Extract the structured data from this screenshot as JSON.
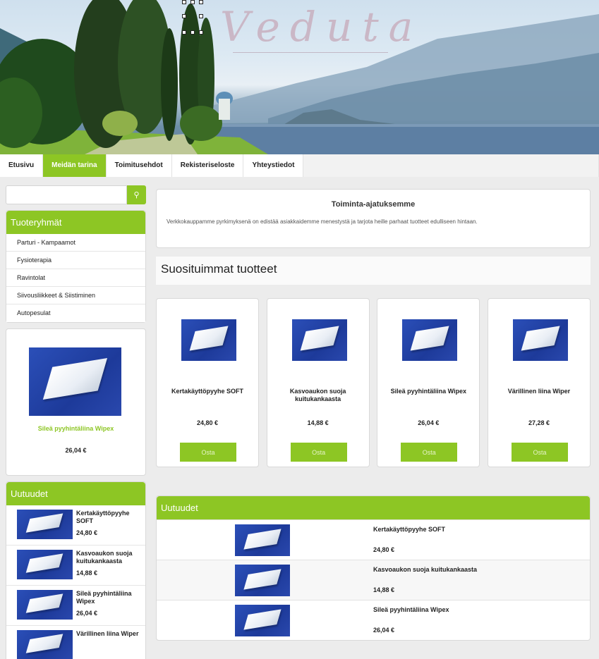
{
  "brand": {
    "logo": "Veduta"
  },
  "nav": [
    "Etusivu",
    "Meidän tarina",
    "Toimitusehdot",
    "Rekisteriseloste",
    "Yhteystiedot"
  ],
  "search": {
    "placeholder": "",
    "button_icon": "search-icon"
  },
  "categories": {
    "title": "Tuoteryhmät",
    "items": [
      "Parturi - Kampaamot",
      "Fysioterapia",
      "Ravintolat",
      "Siivousliikkeet & Siistiminen",
      "Autopesulat"
    ]
  },
  "featured": {
    "name": "Sileä pyyhintäliina Wipex",
    "price": "26,04 €"
  },
  "news_side": {
    "title": "Uutuudet",
    "items": [
      {
        "name": "Kertakäyttöpyyhe SOFT",
        "price": "24,80 €"
      },
      {
        "name": "Kasvoaukon suoja kuitukankaasta",
        "price": "14,88 €"
      },
      {
        "name": "Sileä pyyhintäliina Wipex",
        "price": "26,04 €"
      },
      {
        "name": "Värillinen liina Wiper",
        "price": ""
      }
    ]
  },
  "mission": {
    "title": "Toiminta-ajatuksemme",
    "text": "Verkkokauppamme pyrkimyksenä on edistää asiakkaidemme menestystä ja tarjota heille parhaat tuotteet edulliseen hintaan."
  },
  "popular": {
    "title": "Suosituimmat tuotteet",
    "products": [
      {
        "name": "Kertakäyttöpyyhe SOFT",
        "price": "24,80 €",
        "button": "Osta"
      },
      {
        "name": "Kasvoaukon suoja kuitukankaasta",
        "price": "14,88 €",
        "button": "Osta"
      },
      {
        "name": "Sileä pyyhintäliina Wipex",
        "price": "26,04 €",
        "button": "Osta"
      },
      {
        "name": "Värillinen liina Wiper",
        "price": "27,28 €",
        "button": "Osta"
      }
    ]
  },
  "news_main": {
    "title": "Uutuudet",
    "items": [
      {
        "name": "Kertakäyttöpyyhe SOFT",
        "price": "24,80 €"
      },
      {
        "name": "Kasvoaukon suoja kuitukankaasta",
        "price": "14,88 €"
      },
      {
        "name": "Sileä pyyhintäliina Wipex",
        "price": "26,04 €"
      }
    ]
  },
  "colors": {
    "accent": "#8dc624"
  }
}
